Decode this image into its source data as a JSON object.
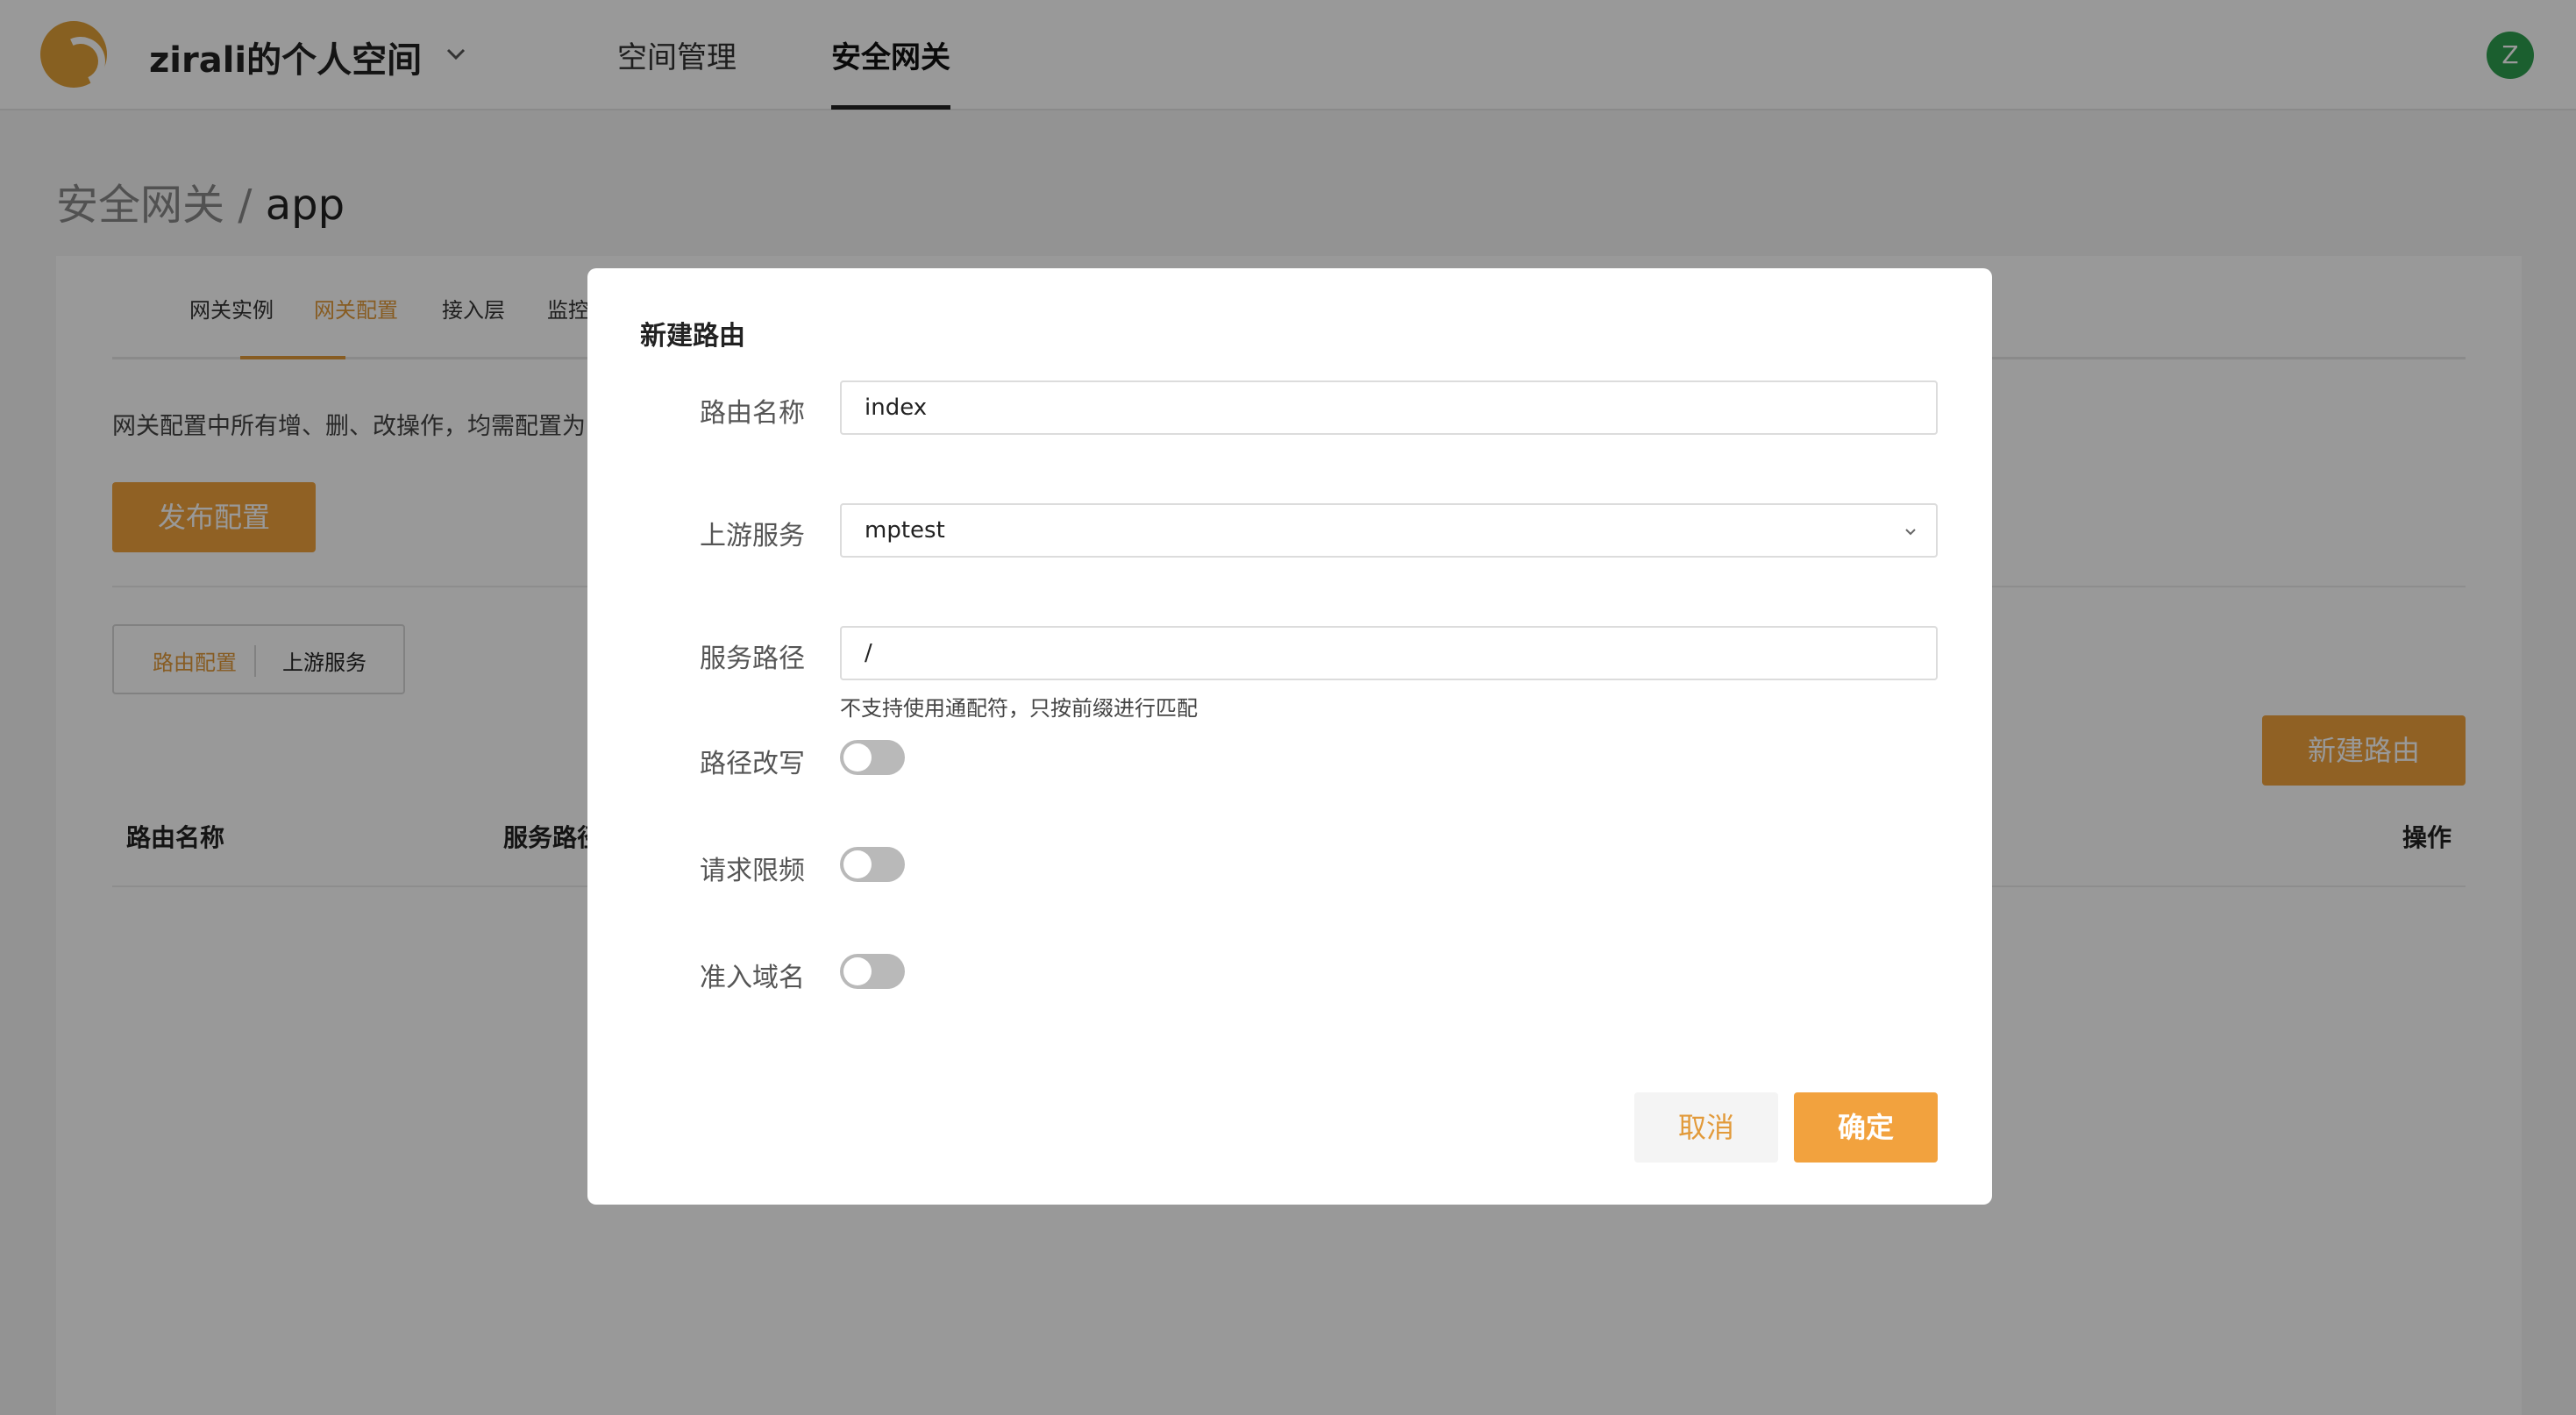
{
  "topnav": {
    "space_title": "zirali的个人空间",
    "items": [
      {
        "label": "空间管理"
      },
      {
        "label": "安全网关"
      }
    ],
    "avatar_letter": "Z"
  },
  "breadcrumb": {
    "parent": "安全网关",
    "separator": " / ",
    "current": "app"
  },
  "tabs": [
    {
      "label": "网关实例"
    },
    {
      "label": "网关配置"
    },
    {
      "label": "接入层"
    },
    {
      "label": "监控视图"
    }
  ],
  "notice": "网关配置中所有增、删、改操作，均需配置为",
  "publish_label": "发布配置",
  "segment": [
    {
      "label": "路由配置"
    },
    {
      "label": "上游服务"
    }
  ],
  "new_route_label": "新建路由",
  "table": {
    "headers": [
      "路由名称",
      "服务路径",
      "操作"
    ]
  },
  "modal": {
    "title": "新建路由",
    "fields": {
      "route_name": {
        "label": "路由名称",
        "value": "index"
      },
      "upstream": {
        "label": "上游服务",
        "value": "mptest"
      },
      "path": {
        "label": "服务路径",
        "value": "/",
        "help": "不支持使用通配符，只按前缀进行匹配"
      },
      "rewrite": {
        "label": "路径改写"
      },
      "rate_limit": {
        "label": "请求限频"
      },
      "domains": {
        "label": "准入域名"
      }
    },
    "cancel_label": "取消",
    "ok_label": "确定"
  },
  "colors": {
    "accent": "#f0a23c",
    "avatar": "#2e9e4f"
  }
}
